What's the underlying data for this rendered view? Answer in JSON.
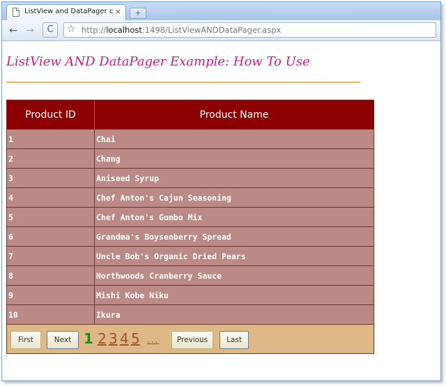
{
  "browser": {
    "tab_title": "ListView and DataPager co...",
    "tab_close": "×",
    "new_tab": "+",
    "back": "←",
    "forward": "→",
    "reload": "C",
    "star": "☆",
    "url_scheme": "http://",
    "url_host": "localhost",
    "url_rest": ":1498/ListViewANDDataPager.aspx"
  },
  "page": {
    "title": "ListView AND DataPager Example: How To Use"
  },
  "table": {
    "columns": [
      "Product ID",
      "Product Name"
    ],
    "rows": [
      {
        "id": "1",
        "name": "Chai"
      },
      {
        "id": "2",
        "name": "Chang"
      },
      {
        "id": "3",
        "name": "Aniseed Syrup"
      },
      {
        "id": "4",
        "name": "Chef Anton's Cajun Seasoning"
      },
      {
        "id": "5",
        "name": "Chef Anton's Gumbo Mix"
      },
      {
        "id": "6",
        "name": "Grandma's Boysenberry Spread"
      },
      {
        "id": "7",
        "name": "Uncle Bob's Organic Dried Pears"
      },
      {
        "id": "8",
        "name": "Northwoods Cranberry Sauce"
      },
      {
        "id": "9",
        "name": "Mishi Kobe Niku"
      },
      {
        "id": "10",
        "name": "Ikura"
      }
    ]
  },
  "pager": {
    "first": "First",
    "next": "Next",
    "current_page": "1",
    "pages": [
      "2",
      "3",
      "4",
      "5"
    ],
    "more": "...",
    "previous": "Previous",
    "last": "Last"
  },
  "colors": {
    "header_bg": "#8b0000",
    "row_bg": "#bc8a86",
    "pager_bg": "#deb887",
    "title_color": "#d4168c",
    "rule_color": "#f7b24a"
  }
}
